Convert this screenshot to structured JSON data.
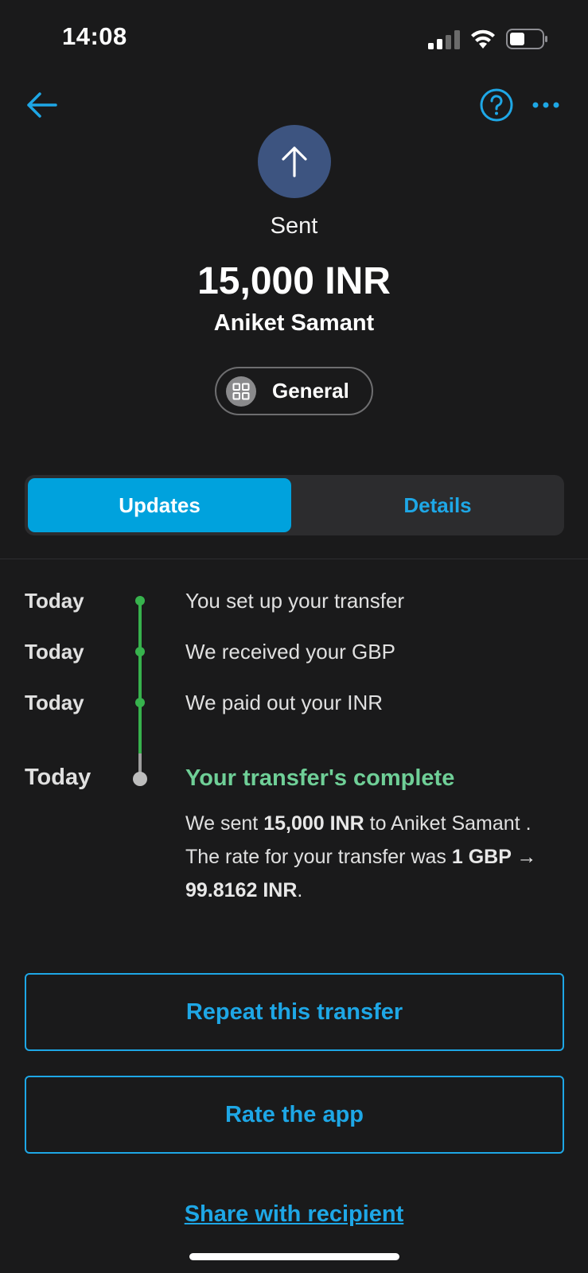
{
  "status_bar": {
    "time": "14:08"
  },
  "nav": {
    "back_icon": "arrow-left-icon",
    "help_icon": "question-circle-icon",
    "more_icon": "ellipsis-icon"
  },
  "header": {
    "direction_icon": "arrow-up-icon",
    "status": "Sent",
    "amount": "15,000 INR",
    "recipient": "Aniket Samant",
    "category": "General",
    "category_icon": "grid-icon"
  },
  "tabs": [
    {
      "label": "Updates",
      "active": true
    },
    {
      "label": "Details",
      "active": false
    }
  ],
  "timeline": [
    {
      "date": "Today",
      "text": "You set up your transfer"
    },
    {
      "date": "Today",
      "text": "We received your GBP"
    },
    {
      "date": "Today",
      "text": "We paid out your INR"
    }
  ],
  "completion": {
    "date": "Today",
    "title": "Your transfer's complete",
    "body_part1": "We sent ",
    "body_amount": "15,000 INR",
    "body_part2": " to Aniket Samant . The rate for your transfer was ",
    "body_rate": "1 GBP → 99.8162 INR",
    "body_part3": "."
  },
  "actions": {
    "repeat_label": "Repeat this transfer",
    "rate_label": "Rate the app",
    "share_label": "Share with recipient"
  },
  "colors": {
    "background": "#1a1a1b",
    "accent": "#1ea7e6",
    "active_tab": "#00a2dd",
    "success": "#6fcf97",
    "timeline_green": "#37b24d",
    "avatar_bg": "#3d5480"
  }
}
